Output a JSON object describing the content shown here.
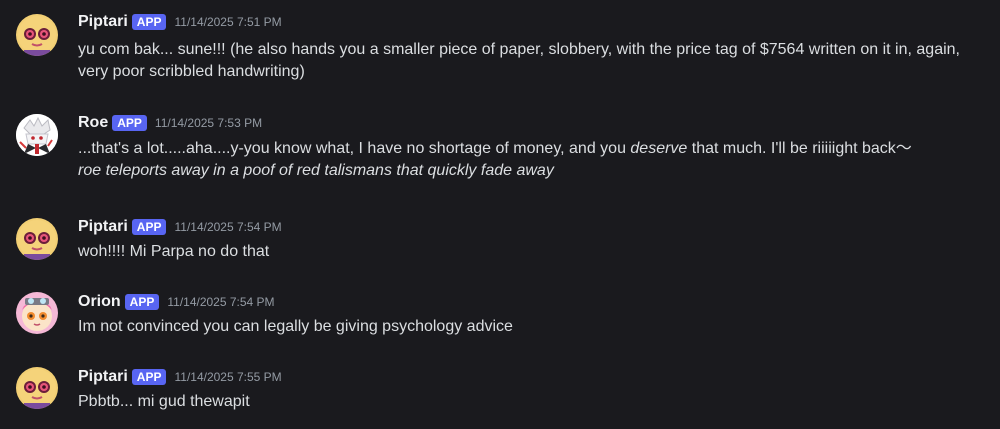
{
  "colors": {
    "background": "#1a1a1e",
    "username": "#f2f3f5",
    "text": "#dbdee1",
    "timestamp": "#949ba4",
    "app_badge": "#5865f2"
  },
  "messages": [
    {
      "avatar": "piptari-avatar",
      "username": "Piptari",
      "badge": "APP",
      "timestamp": "11/14/2025 7:51 PM",
      "text": "yu com bak... sune!!! (he also hands you a smaller piece of paper, slobbery, with the price tag of $7564 written on it in, again, very poor scribbled handwriting)"
    },
    {
      "avatar": "roe-avatar",
      "username": "Roe",
      "badge": "APP",
      "timestamp": "11/14/2025 7:53 PM",
      "text_before": "...that's a lot.....aha....y-you know what, I have no shortage of money, and you ",
      "text_emphasis": "deserve",
      "text_after": " that much. I'll be riiiiight back〜",
      "action": "roe teleports away in a poof of red talismans that quickly fade away"
    },
    {
      "avatar": "piptari-avatar",
      "username": "Piptari",
      "badge": "APP",
      "timestamp": "11/14/2025 7:54 PM",
      "text": "woh!!!! Mi Parpa no do that"
    },
    {
      "avatar": "orion-avatar",
      "username": "Orion",
      "badge": "APP",
      "timestamp": "11/14/2025 7:54 PM",
      "text": "Im not convinced you can legally be giving psychology advice"
    },
    {
      "avatar": "piptari-avatar",
      "username": "Piptari",
      "badge": "APP",
      "timestamp": "11/14/2025 7:55 PM",
      "text": "Pbbtb... mi gud thewapit"
    }
  ]
}
